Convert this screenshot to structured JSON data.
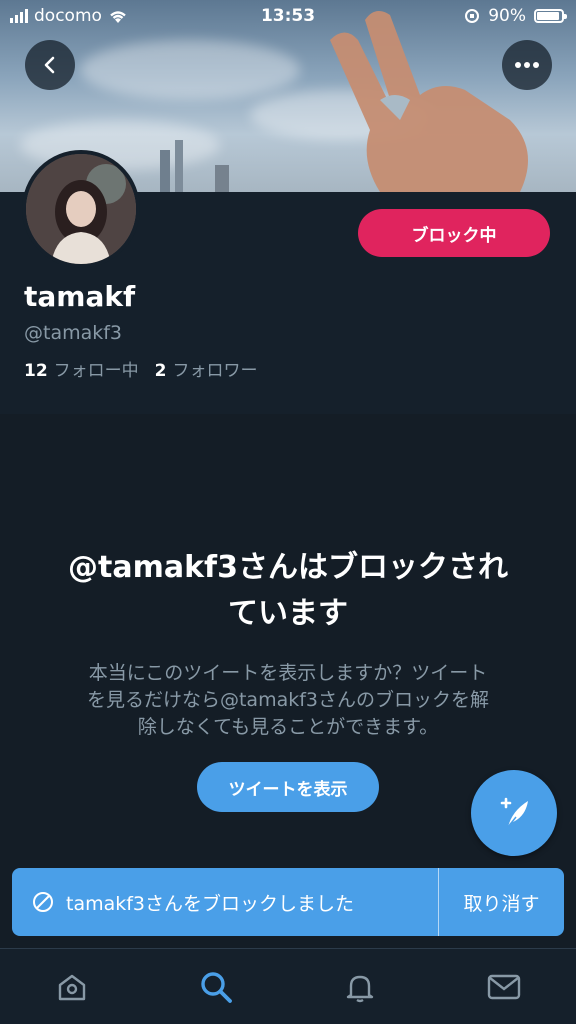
{
  "status": {
    "carrier": "docomo",
    "time": "13:53",
    "battery": "90%",
    "battery_level": 0.9
  },
  "profile": {
    "name": "tamakf",
    "handle": "@tamakf3",
    "following_count": "12",
    "following_label": "フォロー中",
    "followers_count": "2",
    "followers_label": "フォロワー",
    "block_button": "ブロック中"
  },
  "blocked": {
    "title_line1": "@tamakf3さんはブロックされ",
    "title_line2": "ています",
    "desc_line1": "本当にこのツイートを表示しますか？ツイート",
    "desc_line2": "を見るだけなら@tamakf3さんのブロックを解",
    "desc_line3": "除しなくても見ることができます。",
    "show_button": "ツイートを表示"
  },
  "toast": {
    "message": "tamakf3さんをブロックしました",
    "undo": "取り消す"
  },
  "icons": {
    "back": "back-arrow-icon",
    "more": "more-icon",
    "compose": "compose-tweet-icon",
    "home": "home-icon",
    "search": "search-icon",
    "notifications": "bell-icon",
    "messages": "mail-icon",
    "blocked": "block-icon"
  },
  "colors": {
    "accent": "#4a9fe8",
    "block": "#e0245e",
    "background": "#15202b"
  }
}
